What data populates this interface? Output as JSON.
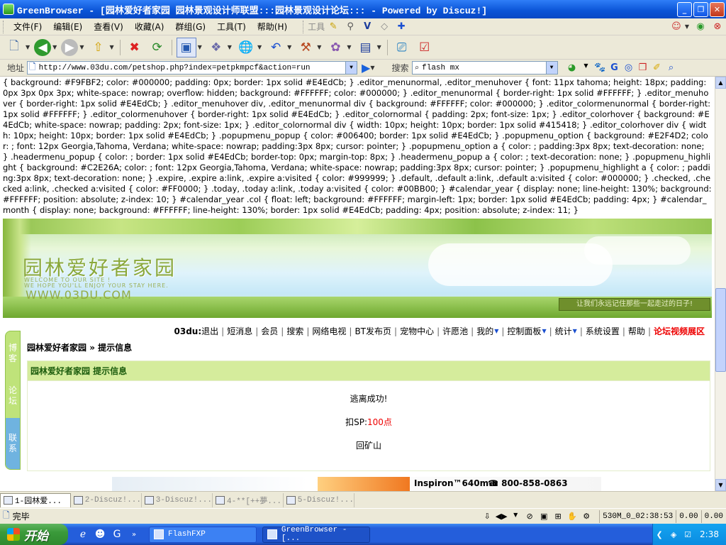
{
  "window": {
    "title": "GreenBrowser - [园林爱好者家园 园林景观设计师联盟:::园林景观设计论坛::: - Powered by Discuz!]",
    "minimize": "_",
    "maximize": "❐",
    "close": "✕"
  },
  "menubar": {
    "items": [
      "文件(F)",
      "编辑(E)",
      "查看(V)",
      "收藏(A)",
      "群组(G)",
      "工具(T)",
      "帮助(H)"
    ],
    "tools_label": "工具"
  },
  "address": {
    "label": "地址",
    "url": "http://www.03du.com/petshop.php?index=petpkmpcf&action=run",
    "search_label": "搜索",
    "search_value": "flash  mx"
  },
  "css_dump": "{ background: #F9FBF2; color: #000000; padding: 0px; border: 1px solid #E4EdCb; } .editor_menunormal, .editor_menuhover { font: 11px tahoma; height: 18px; padding: 0px 3px 0px 3px; white-space: nowrap; overflow: hidden; background: #FFFFFF; color: #000000; } .editor_menunormal { border-right: 1px solid #FFFFFF; } .editor_menuhover { border-right: 1px solid #E4EdCb; } .editor_menuhover div, .editor_menunormal div { background: #FFFFFF; color: #000000; } .editor_colormenunormal { border-right: 1px solid #FFFFFF; } .editor_colormenuhover { border-right: 1px solid #E4EdCb; } .editor_colornormal { padding: 2px; font-size: 1px; } .editor_colorhover { background: #E4EdCb; white-space: nowrap; padding: 2px; font-size: 1px; } .editor_colornormal div { width: 10px; height: 10px; border: 1px solid #415418; } .editor_colorhover div { width: 10px; height: 10px; border: 1px solid #E4EdCb; } .popupmenu_popup { color: #006400; border: 1px solid #E4EdCb; } .popupmenu_option { background: #E2F4D2; color: ; font: 12px Georgia,Tahoma, Verdana; white-space: nowrap; padding:3px 8px; cursor: pointer; } .popupmenu_option a { color: ; padding:3px 8px; text-decoration: none; } .headermenu_popup { color: ; border: 1px solid #E4EdCb; border-top: 0px; margin-top: 8px; } .headermenu_popup a { color: ; text-decoration: none; } .popupmenu_highlight { background: #C2E26A; color: ; font: 12px Georgia,Tahoma, Verdana; white-space: nowrap; padding:3px 8px; cursor: pointer; } .popupmenu_highlight a { color: ; padding:3px 8px; text-decoration: none; } .expire, .expire a:link, .expire a:visited { color: #999999; } .default, .default a:link, .default a:visited { color: #000000; } .checked, .checked a:link, .checked a:visited { color: #FF0000; } .today, .today a:link, .today a:visited { color: #00BB00; } #calendar_year { display: none; line-height: 130%; background: #FFFFFF; position: absolute; z-index: 10; } #calendar_year .col { float: left; background: #FFFFFF; margin-left: 1px; border: 1px solid #E4EdCb; padding: 4px; } #calendar_month { display: none; background: #FFFFFF; line-height: 130%; border: 1px solid #E4EdCb; padding: 4px; position: absolute; z-index: 11; }",
  "banner": {
    "title": "园林爱好者家园",
    "sub1": "WELCOME TO OUR SITE !",
    "sub2": "WE HOPE YOU'LL ENJOY YOUR STAY HERE.",
    "url": "WWW.03DU.COM",
    "sign": "让我们永远记住那些一起走过的日子!"
  },
  "sidetabs": [
    "博客",
    "论坛",
    "联系"
  ],
  "nav": {
    "user": "03du:",
    "links": [
      "退出",
      "短消息",
      "会员",
      "搜索",
      "网络电视",
      "BT发布页",
      "宠物中心",
      "许愿池",
      "我的",
      "控制面板",
      "统计",
      "系统设置",
      "帮助"
    ],
    "special": "论坛视频展区"
  },
  "breadcrumb": {
    "home": "园林爱好者家园",
    "sep": " » ",
    "current": "提示信息"
  },
  "message": {
    "header": "园林爱好者家园 提示信息",
    "line1": "逃离成功!",
    "sp_label": "扣SP:",
    "sp_value": "100点",
    "back_link": "回矿山"
  },
  "ad": {
    "model": "Inspiron™640m-n",
    "phone": "☎ 800-858-0863"
  },
  "tabs": [
    {
      "label": "1-园林爱..."
    },
    {
      "label": "2-Discuz!..."
    },
    {
      "label": "3-Discuz!..."
    },
    {
      "label": "4-**[++夢..."
    },
    {
      "label": "5-Discuz!..."
    }
  ],
  "status": {
    "text": "完毕",
    "cell1": "530M_0_02:38:53",
    "cell2": "0.00",
    "cell3": "0.00"
  },
  "taskbar": {
    "start": "开始",
    "tasks": [
      "FlashFXP",
      "GreenBrowser - [..."
    ],
    "clock": "2:38"
  }
}
